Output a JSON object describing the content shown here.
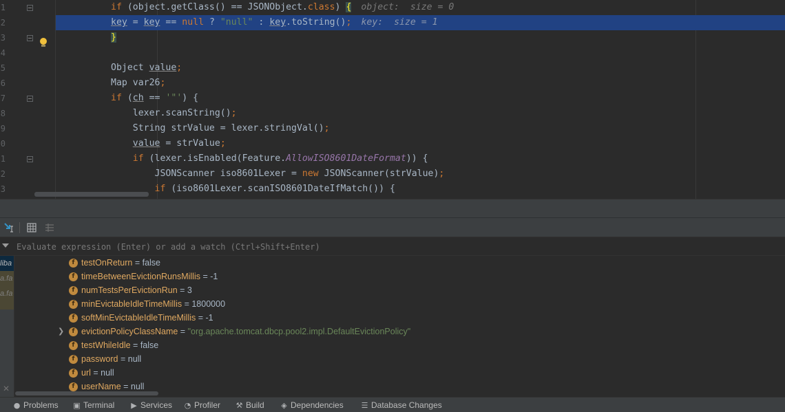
{
  "editor": {
    "line_numbers": [
      "1",
      "2",
      "3",
      "4",
      "5",
      "6",
      "7",
      "8",
      "9",
      "0",
      "1",
      "2",
      "3"
    ],
    "lines": [
      {
        "tokens": [
          [
            "kw",
            "if"
          ],
          [
            "id",
            " (object.getClass() == JSONObject."
          ],
          [
            "kw",
            "class"
          ],
          [
            "id",
            ") "
          ],
          [
            "brace",
            "{"
          ]
        ],
        "hint": "object:  size = 0"
      },
      {
        "tokens": [
          [
            "ul",
            "key"
          ],
          [
            "id",
            " = "
          ],
          [
            "ul",
            "key"
          ],
          [
            "id",
            " == "
          ],
          [
            "kw",
            "null"
          ],
          [
            "id",
            " ? "
          ],
          [
            "str",
            "\"null\""
          ],
          [
            "id",
            " : "
          ],
          [
            "ul",
            "key"
          ],
          [
            "id",
            ".toString()"
          ],
          [
            "kw",
            ";"
          ]
        ],
        "hint": "key:  size = 1"
      },
      {
        "tokens": [
          [
            "brace",
            "}"
          ]
        ],
        "hint": ""
      },
      {
        "tokens": [],
        "hint": ""
      },
      {
        "tokens": [
          [
            "id",
            "Object "
          ],
          [
            "ul",
            "value"
          ],
          [
            "kw",
            ";"
          ]
        ],
        "hint": ""
      },
      {
        "tokens": [
          [
            "id",
            "Map var26"
          ],
          [
            "kw",
            ";"
          ]
        ],
        "hint": ""
      },
      {
        "tokens": [
          [
            "kw",
            "if"
          ],
          [
            "id",
            " ("
          ],
          [
            "ul",
            "ch"
          ],
          [
            "id",
            " == "
          ],
          [
            "str",
            "'\"'"
          ],
          [
            "id",
            ") {"
          ]
        ],
        "hint": ""
      },
      {
        "tokens": [
          [
            "id",
            "    lexer.scanString()"
          ],
          [
            "kw",
            ";"
          ]
        ],
        "hint": ""
      },
      {
        "tokens": [
          [
            "id",
            "    String strValue = lexer.stringVal()"
          ],
          [
            "kw",
            ";"
          ]
        ],
        "hint": ""
      },
      {
        "tokens": [
          [
            "id",
            "    "
          ],
          [
            "ul",
            "value"
          ],
          [
            "id",
            " = strValue"
          ],
          [
            "kw",
            ";"
          ]
        ],
        "hint": ""
      },
      {
        "tokens": [
          [
            "id",
            "    "
          ],
          [
            "kw",
            "if"
          ],
          [
            "id",
            " (lexer.isEnabled(Feature."
          ],
          [
            "fld",
            "AllowISO8601DateFormat"
          ],
          [
            "id",
            ")) {"
          ]
        ],
        "hint": ""
      },
      {
        "tokens": [
          [
            "id",
            "        JSONScanner iso8601Lexer = "
          ],
          [
            "kw",
            "new"
          ],
          [
            "id",
            " JSONScanner(strValue)"
          ],
          [
            "kw",
            ";"
          ]
        ],
        "hint": ""
      },
      {
        "tokens": [
          [
            "id",
            "        "
          ],
          [
            "kw",
            "if"
          ],
          [
            "id",
            " (iso8601Lexer.scanISO8601DateIfMatch()) {"
          ]
        ],
        "hint": ""
      }
    ]
  },
  "evaluate": {
    "placeholder": "Evaluate expression (Enter) or add a watch (Ctrl+Shift+Enter)"
  },
  "frames": [
    {
      "label": "liba",
      "style": "sel"
    },
    {
      "label": "a.fa",
      "style": "lib"
    },
    {
      "label": "a.fa",
      "style": "lib"
    }
  ],
  "variables": [
    {
      "name": "testOnReturn",
      "value": "false",
      "string": false,
      "expandable": false
    },
    {
      "name": "timeBetweenEvictionRunsMillis",
      "value": "-1",
      "string": false,
      "expandable": false
    },
    {
      "name": "numTestsPerEvictionRun",
      "value": "3",
      "string": false,
      "expandable": false
    },
    {
      "name": "minEvictableIdleTimeMillis",
      "value": "1800000",
      "string": false,
      "expandable": false
    },
    {
      "name": "softMinEvictableIdleTimeMillis",
      "value": "-1",
      "string": false,
      "expandable": false
    },
    {
      "name": "evictionPolicyClassName",
      "value": "\"org.apache.tomcat.dbcp.pool2.impl.DefaultEvictionPolicy\"",
      "string": true,
      "expandable": true
    },
    {
      "name": "testWhileIdle",
      "value": "false",
      "string": false,
      "expandable": false
    },
    {
      "name": "password",
      "value": "null",
      "string": false,
      "expandable": false
    },
    {
      "name": "url",
      "value": "null",
      "string": false,
      "expandable": false
    },
    {
      "name": "userName",
      "value": "null",
      "string": false,
      "expandable": false
    }
  ],
  "bottom_bar": [
    {
      "label": "Problems",
      "icon": "problems-icon",
      "glyph": "●"
    },
    {
      "label": "Terminal",
      "icon": "terminal-icon",
      "glyph": "▣"
    },
    {
      "label": "Services",
      "icon": "services-icon",
      "glyph": "▶"
    },
    {
      "label": "Profiler",
      "icon": "profiler-icon",
      "glyph": "◔"
    },
    {
      "label": "Build",
      "icon": "build-icon",
      "glyph": "⚒"
    },
    {
      "label": "Dependencies",
      "icon": "dependencies-icon",
      "glyph": "◈"
    },
    {
      "label": "Database Changes",
      "icon": "database-changes-icon",
      "glyph": "☰"
    }
  ],
  "colors": {
    "current_line": "#214283",
    "keyword": "#cc7832",
    "string": "#6a8759",
    "field_name": "#e0a961",
    "field_icon": "#c08a3e"
  }
}
